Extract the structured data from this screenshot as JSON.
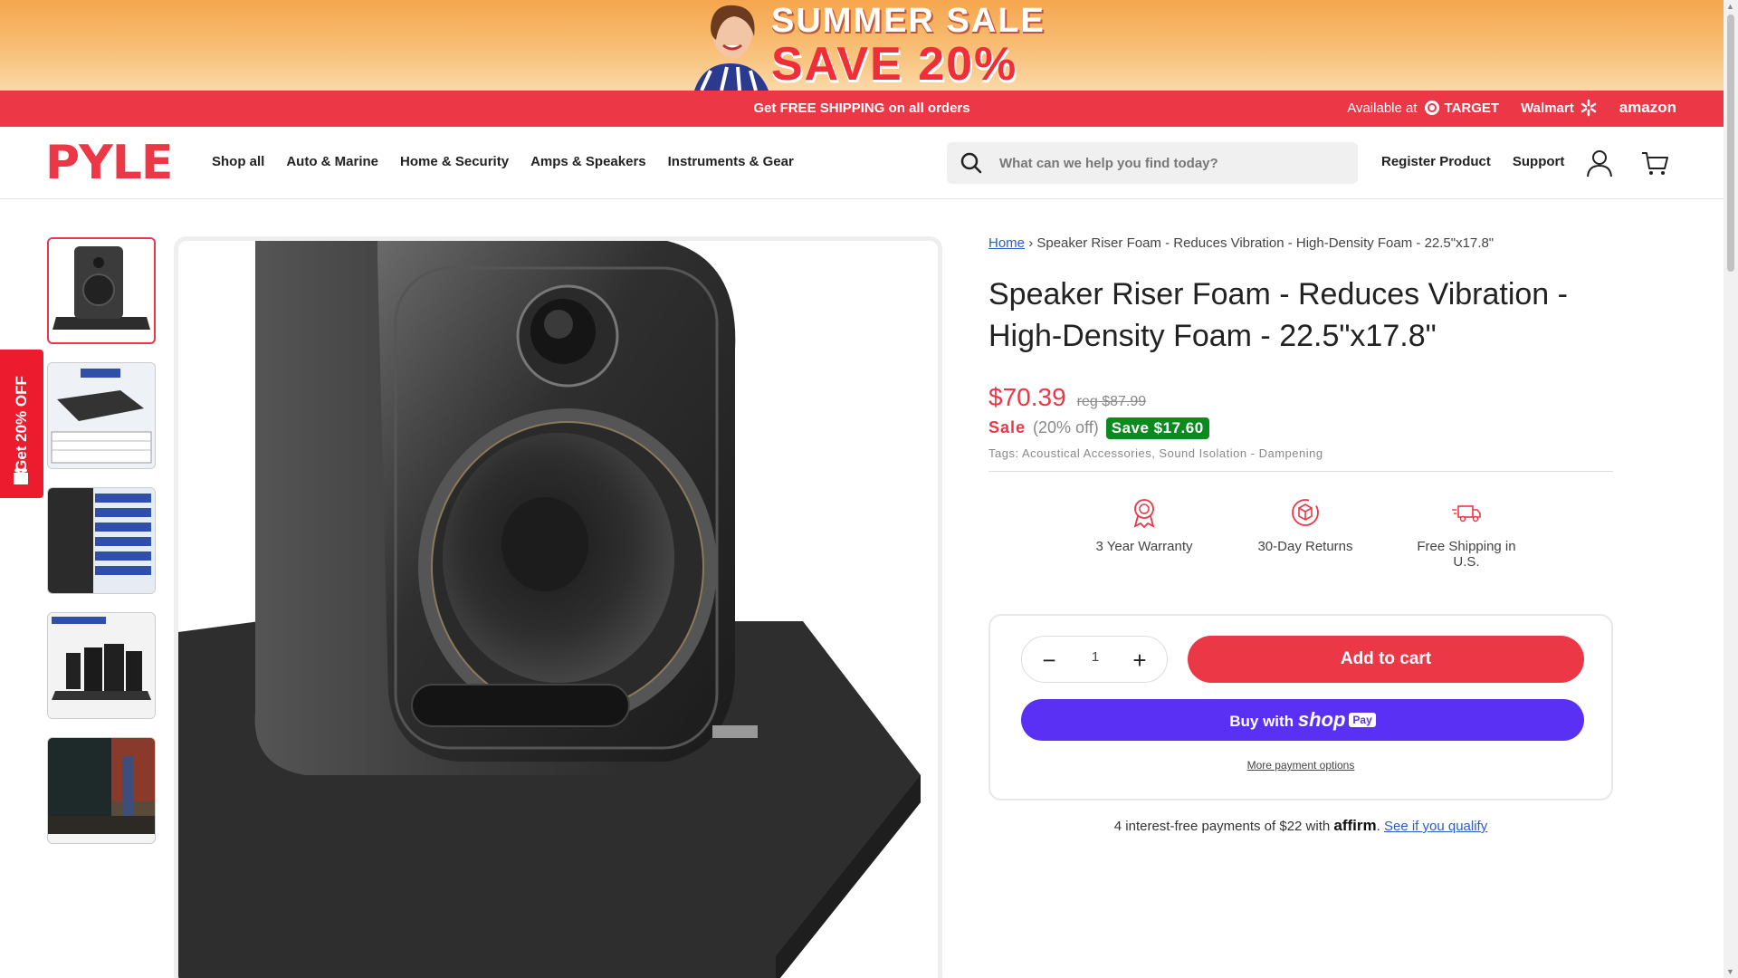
{
  "promo_banner": {
    "line1": "SUMMER SALE",
    "line2": "SAVE 20%"
  },
  "strip": {
    "shipping": "Get FREE SHIPPING on all orders",
    "available_at": "Available at",
    "retailers": [
      "TARGET",
      "Walmart",
      "amazon"
    ]
  },
  "header": {
    "logo": "PYLE",
    "nav": [
      "Shop all",
      "Auto & Marine",
      "Home & Security",
      "Amps & Speakers",
      "Instruments & Gear"
    ],
    "search_placeholder": "What can we help you find today?",
    "links": [
      "Register Product",
      "Support"
    ]
  },
  "side_tab": {
    "label": "Get 20% OFF"
  },
  "breadcrumb": {
    "home": "Home",
    "sep": "›",
    "current": "Speaker Riser Foam - Reduces Vibration - High-Density Foam - 22.5\"x17.8\""
  },
  "product": {
    "title": "Speaker Riser Foam - Reduces Vibration - High-Density Foam - 22.5\"x17.8\"",
    "price": "$70.39",
    "reg_price": "reg $87.99",
    "sale_label": "Sale",
    "percent_off": "(20% off)",
    "save_badge": "Save $17.60",
    "tags_label": "Tags:",
    "tags": "Acoustical Accessories, Sound Isolation - Dampening"
  },
  "perks": [
    {
      "icon": "award-ribbon-icon",
      "label": "3 Year Warranty"
    },
    {
      "icon": "return-box-icon",
      "label": "30-Day Returns"
    },
    {
      "icon": "delivery-truck-icon",
      "label": "Free Shipping in U.S."
    }
  ],
  "buy": {
    "quantity": "1",
    "add_to_cart": "Add to cart",
    "buy_with": "Buy with",
    "shop": "shop",
    "pay": "Pay",
    "more_options": "More payment options"
  },
  "affirm": {
    "text": "4 interest-free payments of $22 with",
    "brand": "affirm",
    "period": ".",
    "link": "See if you qualify"
  },
  "colors": {
    "brand_red": "#ec3746",
    "shop_pay_purple": "#5a31f4",
    "save_green": "#0a8a1f"
  }
}
